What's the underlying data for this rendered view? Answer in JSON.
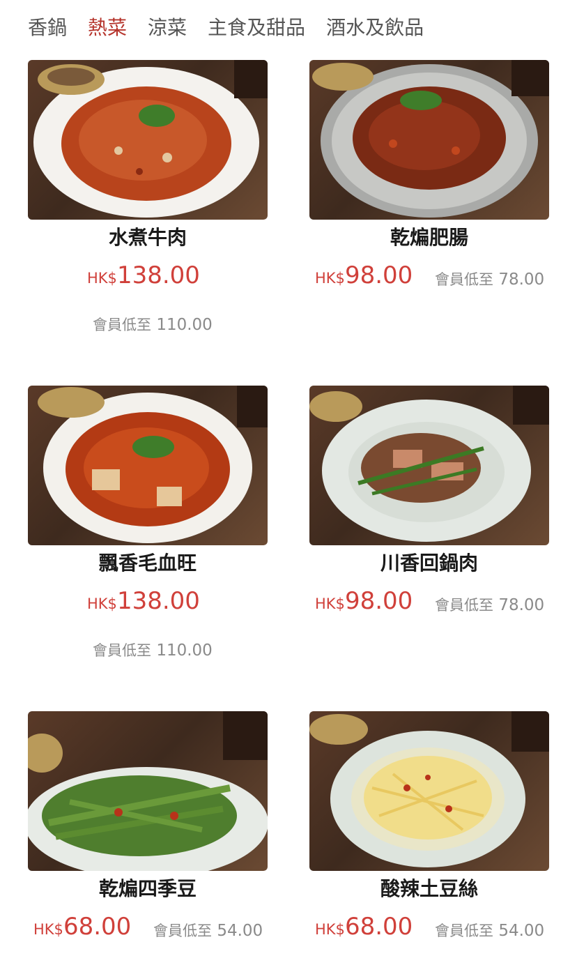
{
  "tabs": [
    {
      "label": "香鍋",
      "active": false
    },
    {
      "label": "熱菜",
      "active": true
    },
    {
      "label": "涼菜",
      "active": false
    },
    {
      "label": "主食及甜品",
      "active": false
    },
    {
      "label": "酒水及飲品",
      "active": false
    }
  ],
  "colors": {
    "accent": "#b5332b",
    "price": "#d0403a",
    "muted": "#8a8a8a",
    "text": "#1a1a1a"
  },
  "currency": "HK$",
  "member_label": "會員低至",
  "dishes": [
    {
      "name": "水煮牛肉",
      "price": "138.00",
      "member_price": "110.00"
    },
    {
      "name": "乾煸肥腸",
      "price": "98.00",
      "member_price": "78.00"
    },
    {
      "name": "飄香毛血旺",
      "price": "138.00",
      "member_price": "110.00"
    },
    {
      "name": "川香回鍋肉",
      "price": "98.00",
      "member_price": "78.00"
    },
    {
      "name": "乾煸四季豆",
      "price": "68.00",
      "member_price": "54.00"
    },
    {
      "name": "酸辣土豆絲",
      "price": "68.00",
      "member_price": "54.00"
    }
  ]
}
